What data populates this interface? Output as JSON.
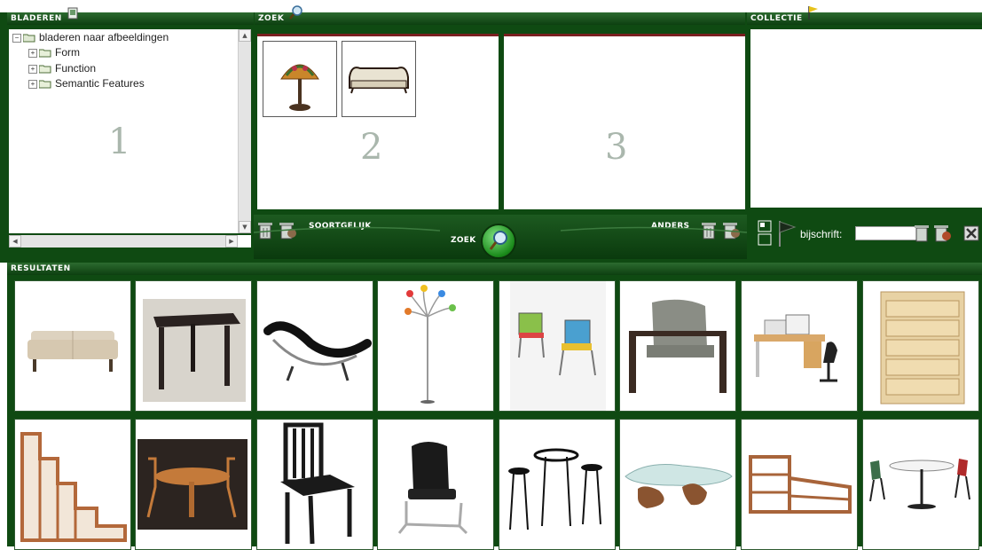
{
  "panels": {
    "browse": {
      "title": "BLADEREN",
      "number": "1"
    },
    "search": {
      "title": "ZOEK",
      "similar_label": "SOORTGELIJK",
      "other_label": "ANDERS",
      "search_button": "ZOEK",
      "query_number": "2",
      "negative_number": "3"
    },
    "collection": {
      "title": "COLLECTIE",
      "caption_label": "bijschrift:",
      "caption_value": ""
    },
    "results": {
      "title": "RESULTATEN"
    }
  },
  "tree": {
    "root": "bladeren naar afbeeldingen",
    "items": [
      "Form",
      "Function",
      "Semantic Features"
    ]
  },
  "query_images": [
    "tiffany-lamp",
    "sofa-antique"
  ],
  "results_row1": [
    "sofa",
    "table",
    "chaise-longue",
    "floor-lamp",
    "chairs",
    "armchair",
    "computer-desk",
    "dresser"
  ],
  "results_row2": [
    "step-shelf",
    "dining-set",
    "wooden-chair",
    "office-chair",
    "bar-set",
    "glass-table",
    "corner-shelf",
    "patio-set"
  ],
  "colors": {
    "dark_green": "#0f4a12",
    "header_green": "#2c6b2f"
  }
}
